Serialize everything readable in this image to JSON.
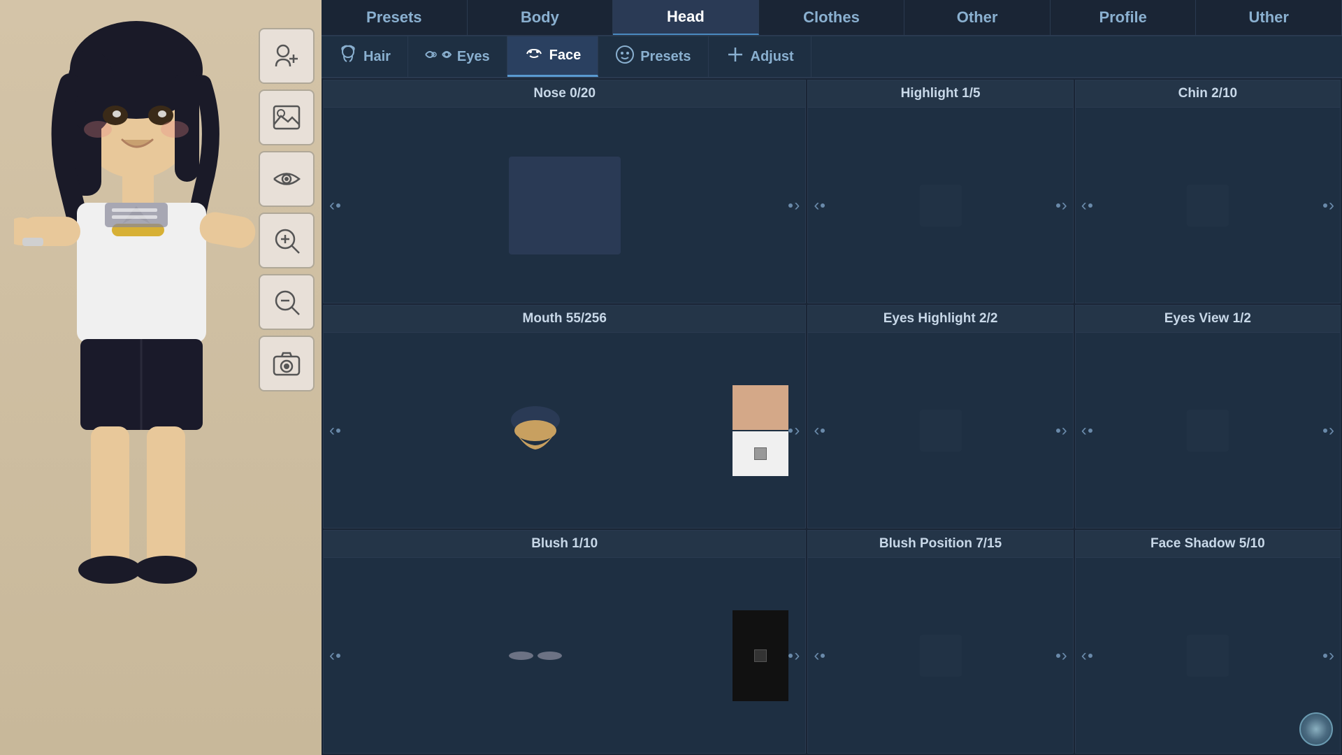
{
  "top_nav": {
    "tabs": [
      {
        "id": "presets",
        "label": "Presets",
        "active": false
      },
      {
        "id": "body",
        "label": "Body",
        "active": false
      },
      {
        "id": "head",
        "label": "Head",
        "active": true
      },
      {
        "id": "clothes",
        "label": "Clothes",
        "active": false
      },
      {
        "id": "other",
        "label": "Other",
        "active": false
      },
      {
        "id": "profile",
        "label": "Profile",
        "active": false
      },
      {
        "id": "uther",
        "label": "Uther",
        "active": false
      }
    ]
  },
  "sub_nav": {
    "tabs": [
      {
        "id": "hair",
        "label": "Hair",
        "icon": "👤",
        "active": false
      },
      {
        "id": "eyes",
        "label": "Eyes",
        "icon": "👁️",
        "active": false
      },
      {
        "id": "face",
        "label": "Face",
        "icon": "😶",
        "active": true
      },
      {
        "id": "presets",
        "label": "Presets",
        "icon": "🙂",
        "active": false
      },
      {
        "id": "adjust",
        "label": "Adjust",
        "icon": "✛",
        "active": false
      }
    ]
  },
  "features": [
    {
      "id": "nose",
      "title": "Nose 0/20",
      "current": 0,
      "max": 20,
      "type": "nose"
    },
    {
      "id": "highlight",
      "title": "Highlight 1/5",
      "current": 1,
      "max": 5,
      "type": "empty"
    },
    {
      "id": "chin",
      "title": "Chin 2/10",
      "current": 2,
      "max": 10,
      "type": "empty"
    },
    {
      "id": "mouth",
      "title": "Mouth 55/256",
      "current": 55,
      "max": 256,
      "type": "mouth"
    },
    {
      "id": "eyes_highlight",
      "title": "Eyes Highlight 2/2",
      "current": 2,
      "max": 2,
      "type": "empty"
    },
    {
      "id": "eyes_view",
      "title": "Eyes View 1/2",
      "current": 1,
      "max": 2,
      "type": "empty"
    },
    {
      "id": "blush",
      "title": "Blush 1/10",
      "current": 1,
      "max": 10,
      "type": "blush"
    },
    {
      "id": "blush_position",
      "title": "Blush Position 7/15",
      "current": 7,
      "max": 15,
      "type": "empty"
    },
    {
      "id": "face_shadow",
      "title": "Face Shadow 5/10",
      "current": 5,
      "max": 10,
      "type": "empty"
    }
  ],
  "tool_buttons": [
    {
      "id": "add-character",
      "icon": "👤+",
      "unicode": "➕"
    },
    {
      "id": "image",
      "icon": "🖼️"
    },
    {
      "id": "eye-toggle",
      "icon": "👁️"
    },
    {
      "id": "zoom-in",
      "icon": "🔍+"
    },
    {
      "id": "zoom-out",
      "icon": "🔍-"
    },
    {
      "id": "camera",
      "icon": "📷"
    }
  ]
}
